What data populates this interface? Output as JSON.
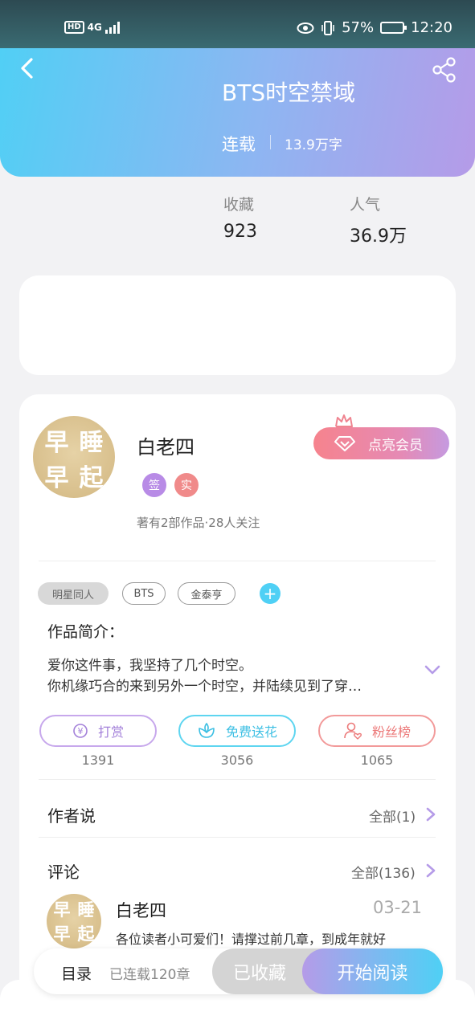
{
  "status_bar": {
    "network": "4G",
    "hd_label": "HD",
    "battery_percent": "57%",
    "battery_level": 0.57,
    "time": "12:20"
  },
  "header": {
    "back_icon": "chevron-left-icon",
    "share_icon": "share-icon",
    "title": "BTS时空禁域",
    "status": "连载",
    "word_count": "13.9万字"
  },
  "stats": {
    "favorites_label": "收藏",
    "favorites_value": "923",
    "popularity_label": "人气",
    "popularity_value": "36.9万"
  },
  "author": {
    "avatar_text": [
      "早",
      "睡",
      "早",
      "起"
    ],
    "name": "白老四",
    "badges": [
      "签",
      "实"
    ],
    "stats_text": "著有2部作品·28人关注",
    "vip_button": "点亮会员"
  },
  "tags": [
    "明星同人",
    "BTS",
    "金泰亨"
  ],
  "intro": {
    "title": "作品简介：",
    "line1": "爱你这件事，我坚持了几个时空。",
    "line2": "你机缘巧合的来到另外一个时空，并陆续见到了穿…"
  },
  "actions": [
    {
      "label": "打赏",
      "icon": "yen-coin-icon",
      "count": "1391"
    },
    {
      "label": "免费送花",
      "icon": "flower-icon",
      "count": "3056"
    },
    {
      "label": "粉丝榜",
      "icon": "fan-user-icon",
      "count": "1065"
    }
  ],
  "author_notes": {
    "title": "作者说",
    "link": "全部(1)"
  },
  "comments": {
    "title": "评论",
    "link": "全部(136)",
    "first": {
      "name": "白老四",
      "date": "03-21",
      "text": "各位读者小可爱们！请撑过前几章，到成年就好"
    }
  },
  "bottom_bar": {
    "toc": "目录",
    "chapters": "已连载120章",
    "collected": "已收藏",
    "read": "开始阅读"
  },
  "colors": {
    "header_gradient_start": "#4fd0f5",
    "header_gradient_end": "#b59be8",
    "accent_blue": "#4fd0f5",
    "accent_purple": "#b59be8",
    "vip_pink": "#f6838d"
  }
}
